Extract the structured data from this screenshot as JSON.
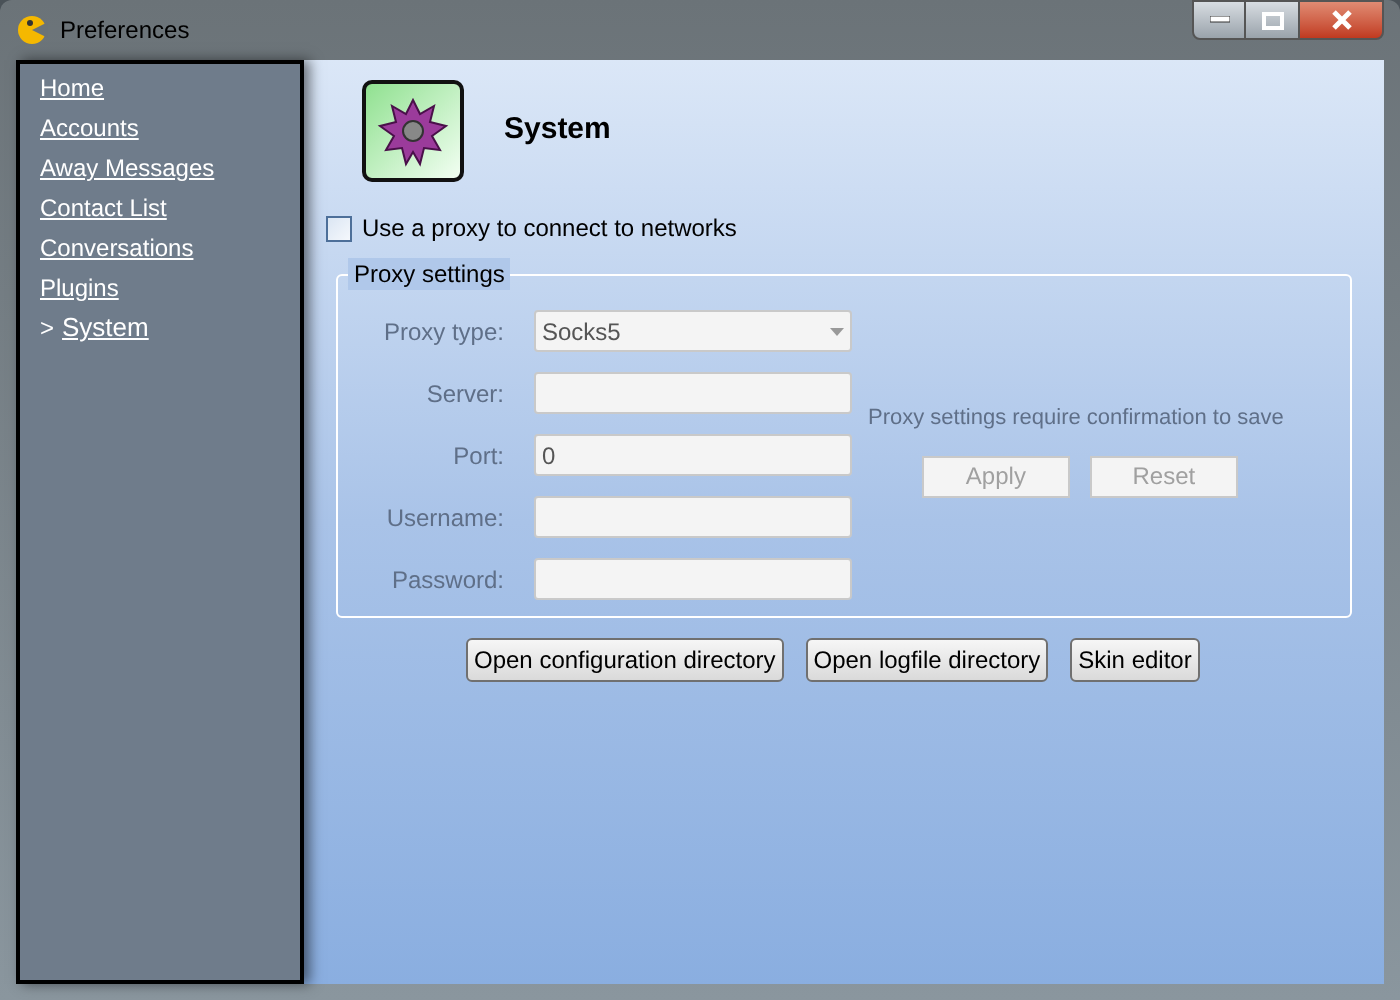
{
  "window": {
    "title": "Preferences"
  },
  "sidebar": {
    "selected_marker": ">",
    "items": [
      {
        "label": "Home",
        "selected": false
      },
      {
        "label": "Accounts",
        "selected": false
      },
      {
        "label": "Away Messages",
        "selected": false
      },
      {
        "label": "Contact List",
        "selected": false
      },
      {
        "label": "Conversations",
        "selected": false
      },
      {
        "label": "Plugins",
        "selected": false
      },
      {
        "label": "System",
        "selected": true
      }
    ]
  },
  "header": {
    "title": "System"
  },
  "proxy_checkbox": {
    "label": "Use a proxy to connect to networks",
    "checked": false
  },
  "proxy_settings": {
    "title": "Proxy settings",
    "disabled": true,
    "fields": [
      {
        "label": "Proxy type:",
        "kind": "dropdown",
        "value": "Socks5"
      },
      {
        "label": "Server:",
        "kind": "text"
      },
      {
        "label": "Port:",
        "kind": "text",
        "value": "0"
      },
      {
        "label": "Username:",
        "kind": "text"
      },
      {
        "label": "Password:",
        "kind": "password"
      }
    ],
    "note": "Proxy settings require confirmation to save",
    "buttons": [
      {
        "label": "Apply",
        "disabled": true
      },
      {
        "label": "Reset",
        "disabled": true
      }
    ]
  },
  "buttons": [
    {
      "label": "Open configuration directory"
    },
    {
      "label": "Open logfile directory"
    },
    {
      "label": "Skin editor"
    }
  ]
}
